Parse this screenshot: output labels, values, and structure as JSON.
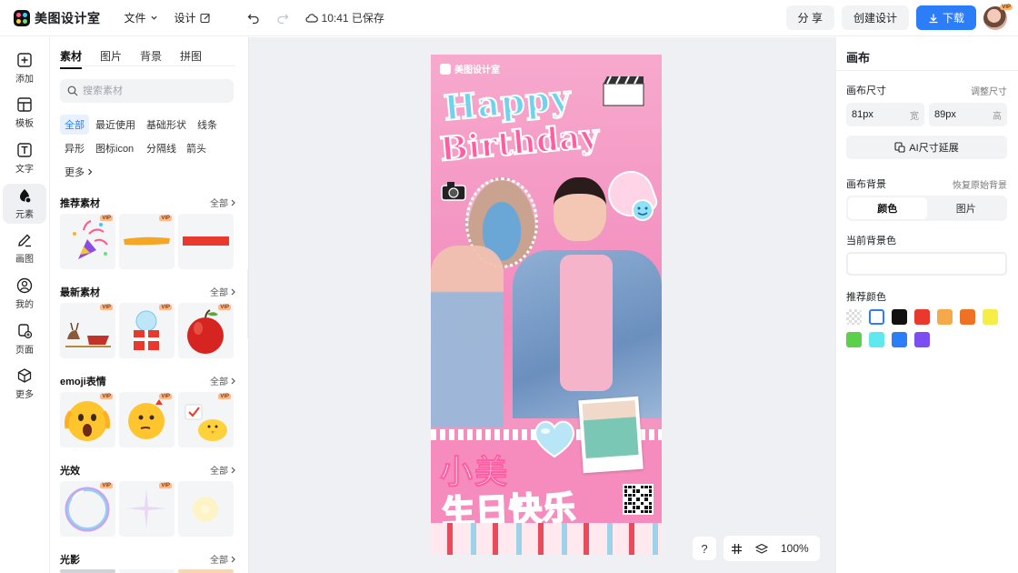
{
  "app": {
    "name": "美图设计室"
  },
  "menu": {
    "file": "文件",
    "design": "设计"
  },
  "status": {
    "saved": "10:41 已保存"
  },
  "header_actions": {
    "share": "分 享",
    "create": "创建设计",
    "download": "下载",
    "avatar_badge": "VIP"
  },
  "leftnav": [
    {
      "label": "添加",
      "icon": "plus-square-icon"
    },
    {
      "label": "模板",
      "icon": "template-icon"
    },
    {
      "label": "文字",
      "icon": "text-icon"
    },
    {
      "label": "元素",
      "icon": "shapes-icon"
    },
    {
      "label": "画图",
      "icon": "draw-icon"
    },
    {
      "label": "我的",
      "icon": "user-icon"
    },
    {
      "label": "页面",
      "icon": "page-add-icon"
    },
    {
      "label": "更多",
      "icon": "cube-icon"
    }
  ],
  "panel": {
    "tabs": [
      "素材",
      "图片",
      "背景",
      "拼图"
    ],
    "search_placeholder": "搜索素材",
    "chips": [
      "全部",
      "最近使用",
      "基础形状",
      "线条",
      "异形",
      "图标icon",
      "分隔线",
      "箭头",
      "更多"
    ],
    "all_label": "全部",
    "vip": "VIP",
    "sections": [
      {
        "title": "推荐素材"
      },
      {
        "title": "最新素材"
      },
      {
        "title": "emoji表情"
      },
      {
        "title": "光效"
      },
      {
        "title": "光影"
      }
    ]
  },
  "poster": {
    "brand": "美图设计室",
    "title_en_1": "Happy",
    "title_en_2": "Birthday",
    "title_cn_1": "小美",
    "title_cn_2": "生日快乐"
  },
  "canvas_tools": {
    "help": "?",
    "zoom": "100%"
  },
  "rpanel": {
    "title": "画布",
    "size_label": "画布尺寸",
    "size_adjust": "调整尺寸",
    "width_value": "81px",
    "width_unit": "宽",
    "height_value": "89px",
    "height_unit": "高",
    "ai_extend": "AI尺寸延展",
    "bg_label": "画布背景",
    "bg_reset": "恢复原始背景",
    "seg_color": "颜色",
    "seg_image": "图片",
    "current_bg": "当前背景色",
    "recommend": "推荐颜色",
    "colors": [
      "transparent",
      "#ffffff",
      "#111111",
      "#e9392d",
      "#f5a94b",
      "#ee7124",
      "#f5ee45",
      "#5bd04a",
      "#5fe8ee",
      "#2b7df8",
      "#7b4ef2"
    ]
  }
}
